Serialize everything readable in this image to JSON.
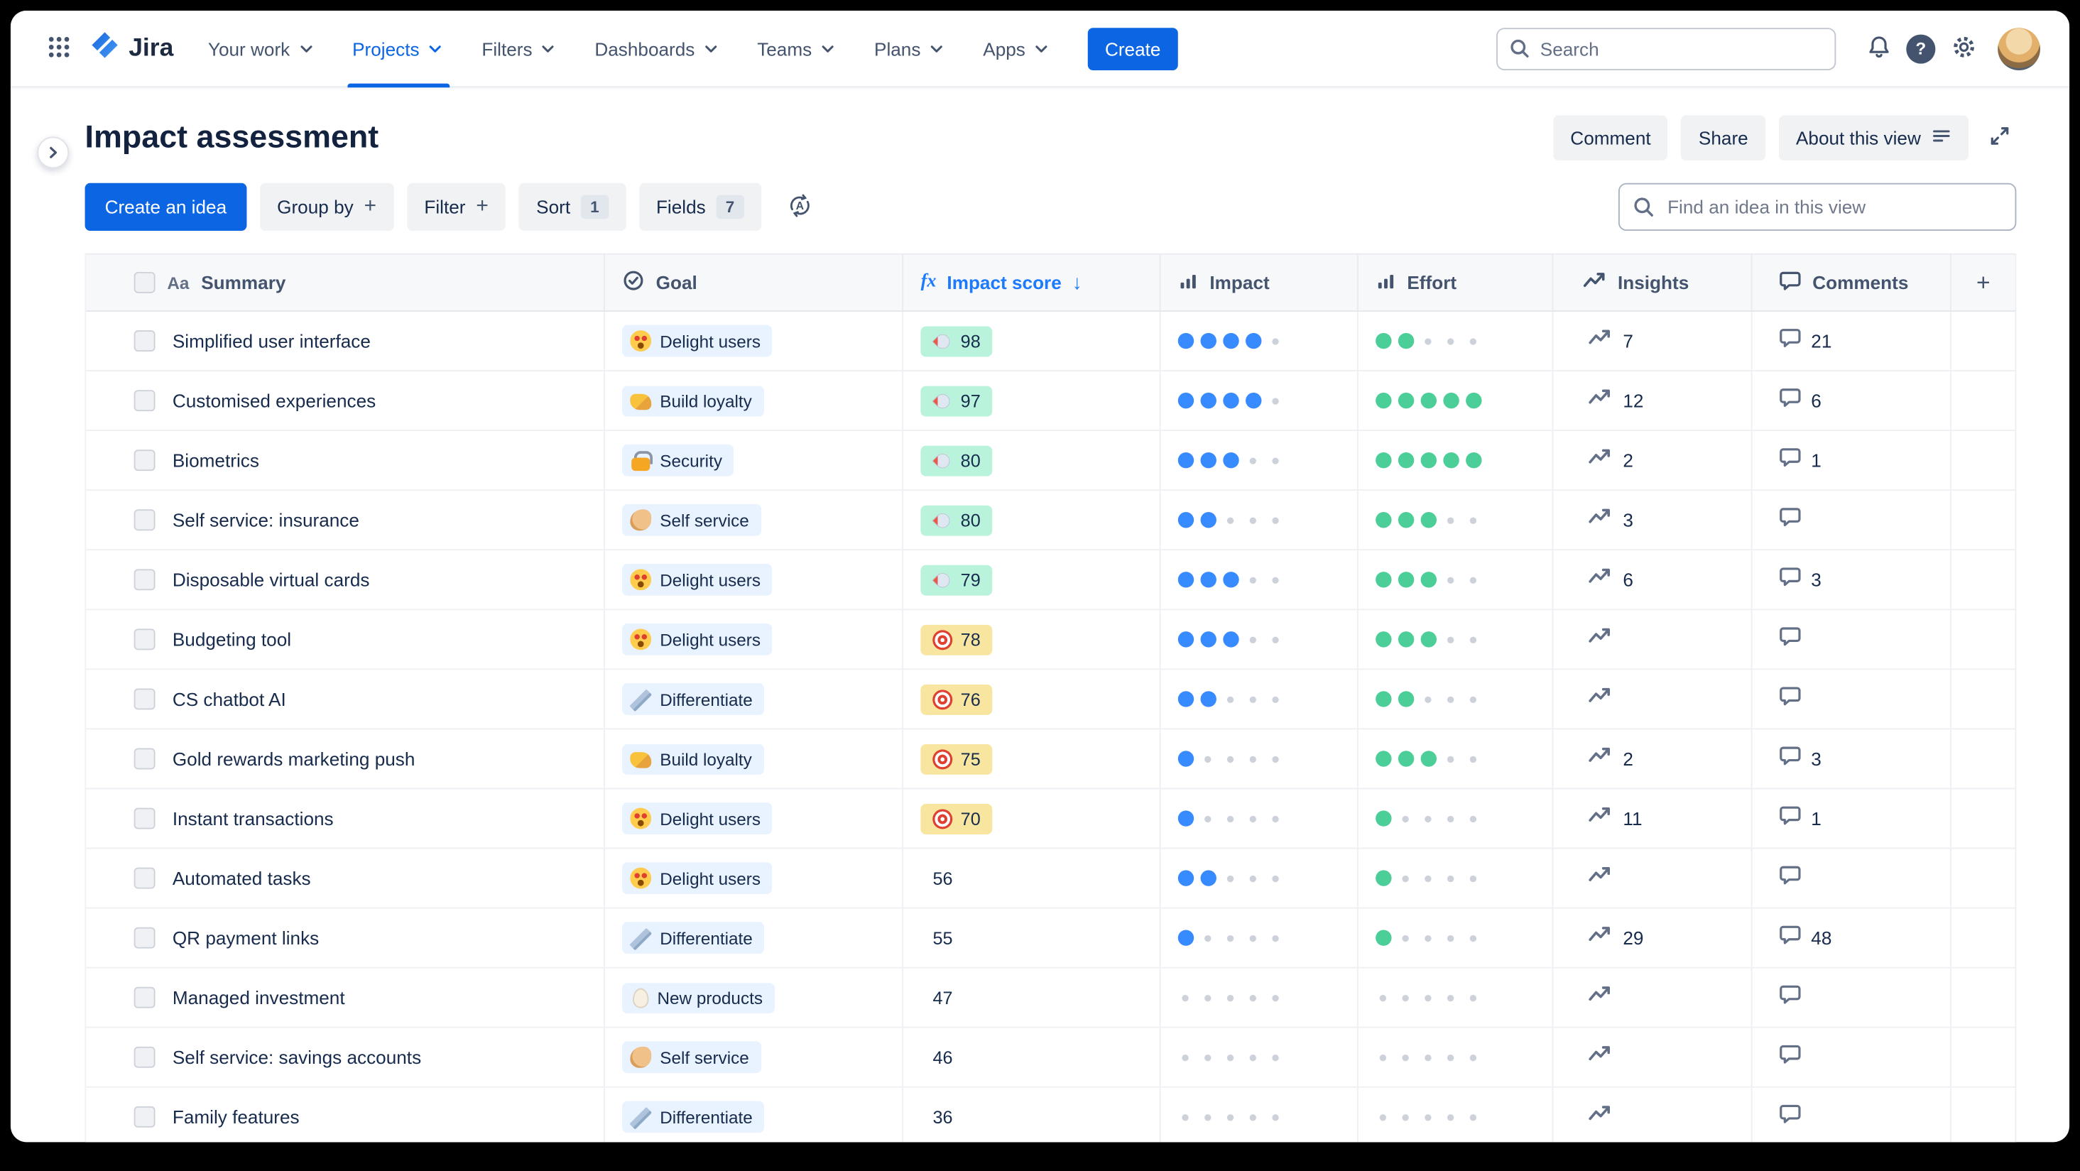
{
  "nav": {
    "logo_text": "Jira",
    "items": [
      {
        "label": "Your work"
      },
      {
        "label": "Projects",
        "active": true
      },
      {
        "label": "Filters"
      },
      {
        "label": "Dashboards"
      },
      {
        "label": "Teams"
      },
      {
        "label": "Plans"
      },
      {
        "label": "Apps"
      }
    ],
    "create_label": "Create",
    "search_placeholder": "Search"
  },
  "header": {
    "title": "Impact assessment",
    "comment_label": "Comment",
    "share_label": "Share",
    "about_label": "About this view"
  },
  "toolbar": {
    "create_idea_label": "Create an idea",
    "group_by_label": "Group by",
    "filter_label": "Filter",
    "sort_label": "Sort",
    "sort_count": "1",
    "fields_label": "Fields",
    "fields_count": "7",
    "find_placeholder": "Find an idea in this view"
  },
  "glyphs": {
    "aa": "Aa",
    "fx": "fx",
    "sort_desc": "↓",
    "plus": "+",
    "help": "?",
    "add_column": "+"
  },
  "table": {
    "columns": {
      "summary": "Summary",
      "goal": "Goal",
      "impact_score": "Impact score",
      "impact": "Impact",
      "effort": "Effort",
      "insights": "Insights",
      "comments": "Comments"
    },
    "rows": [
      {
        "summary": "Simplified user interface",
        "goal": "Delight users",
        "goal_emoji": "😍",
        "goal_icon": "heart-eyes",
        "score": "98",
        "score_tier": "green",
        "score_emoji": "🚀",
        "score_icon": "rocket",
        "impact": 4,
        "effort": 2,
        "insights": "7",
        "comments": "21"
      },
      {
        "summary": "Customised experiences",
        "goal": "Build loyalty",
        "goal_emoji": "🤝",
        "goal_icon": "handshake",
        "score": "97",
        "score_tier": "green",
        "score_emoji": "🚀",
        "score_icon": "rocket",
        "impact": 4,
        "effort": 5,
        "insights": "12",
        "comments": "6"
      },
      {
        "summary": "Biometrics",
        "goal": "Security",
        "goal_emoji": "🔐",
        "goal_icon": "lock",
        "score": "80",
        "score_tier": "green",
        "score_emoji": "🚀",
        "score_icon": "rocket",
        "impact": 3,
        "effort": 5,
        "insights": "2",
        "comments": "1"
      },
      {
        "summary": "Self service: insurance",
        "goal": "Self service",
        "goal_emoji": "💪",
        "goal_icon": "muscle",
        "score": "80",
        "score_tier": "green",
        "score_emoji": "🚀",
        "score_icon": "rocket",
        "impact": 2,
        "effort": 3,
        "insights": "3",
        "comments": null
      },
      {
        "summary": "Disposable virtual cards",
        "goal": "Delight users",
        "goal_emoji": "😍",
        "goal_icon": "heart-eyes",
        "score": "79",
        "score_tier": "green",
        "score_emoji": "🚀",
        "score_icon": "rocket",
        "impact": 3,
        "effort": 3,
        "insights": "6",
        "comments": "3"
      },
      {
        "summary": "Budgeting tool",
        "goal": "Delight users",
        "goal_emoji": "😍",
        "goal_icon": "heart-eyes",
        "score": "78",
        "score_tier": "yellow",
        "score_emoji": "🎯",
        "score_icon": "dart",
        "impact": 3,
        "effort": 3,
        "insights": null,
        "comments": null
      },
      {
        "summary": "CS chatbot AI",
        "goal": "Differentiate",
        "goal_emoji": "📏",
        "goal_icon": "ruler",
        "score": "76",
        "score_tier": "yellow",
        "score_emoji": "🎯",
        "score_icon": "dart",
        "impact": 2,
        "effort": 2,
        "insights": null,
        "comments": null
      },
      {
        "summary": "Gold rewards marketing push",
        "goal": "Build loyalty",
        "goal_emoji": "🤝",
        "goal_icon": "handshake",
        "score": "75",
        "score_tier": "yellow",
        "score_emoji": "🎯",
        "score_icon": "dart",
        "impact": 1,
        "effort": 3,
        "insights": "2",
        "comments": "3"
      },
      {
        "summary": "Instant transactions",
        "goal": "Delight users",
        "goal_emoji": "😍",
        "goal_icon": "heart-eyes",
        "score": "70",
        "score_tier": "yellow",
        "score_emoji": "🎯",
        "score_icon": "dart",
        "impact": 1,
        "effort": 1,
        "insights": "11",
        "comments": "1"
      },
      {
        "summary": "Automated tasks",
        "goal": "Delight users",
        "goal_emoji": "😍",
        "goal_icon": "heart-eyes",
        "score": "56",
        "score_tier": null,
        "score_emoji": null,
        "score_icon": null,
        "impact": 2,
        "effort": 1,
        "insights": null,
        "comments": null
      },
      {
        "summary": "QR payment links",
        "goal": "Differentiate",
        "goal_emoji": "📏",
        "goal_icon": "ruler",
        "score": "55",
        "score_tier": null,
        "score_emoji": null,
        "score_icon": null,
        "impact": 1,
        "effort": 1,
        "insights": "29",
        "comments": "48"
      },
      {
        "summary": "Managed investment",
        "goal": "New products",
        "goal_emoji": "🥚",
        "goal_icon": "egg",
        "score": "47",
        "score_tier": null,
        "score_emoji": null,
        "score_icon": null,
        "impact": 0,
        "effort": 0,
        "insights": null,
        "comments": null
      },
      {
        "summary": "Self service: savings accounts",
        "goal": "Self service",
        "goal_emoji": "💪",
        "goal_icon": "muscle",
        "score": "46",
        "score_tier": null,
        "score_emoji": null,
        "score_icon": null,
        "impact": 0,
        "effort": 0,
        "insights": null,
        "comments": null
      },
      {
        "summary": "Family features",
        "goal": "Differentiate",
        "goal_emoji": "📏",
        "goal_icon": "ruler",
        "score": "36",
        "score_tier": null,
        "score_emoji": null,
        "score_icon": null,
        "impact": 0,
        "effort": 0,
        "insights": null,
        "comments": null
      }
    ]
  },
  "colors": {
    "brand_blue": "#0C66E4",
    "impact_score_header": "#1D7AFC",
    "score_green_bg": "#BAF3DB",
    "score_yellow_bg": "#F8E6A0",
    "goal_chip_bg": "#E9F2FF",
    "impact_dot": "#388BFF",
    "effort_dot": "#4BCE97",
    "empty_dot": "#CDD2DA",
    "header_text": "#44546F",
    "body_text": "#172B4D"
  }
}
